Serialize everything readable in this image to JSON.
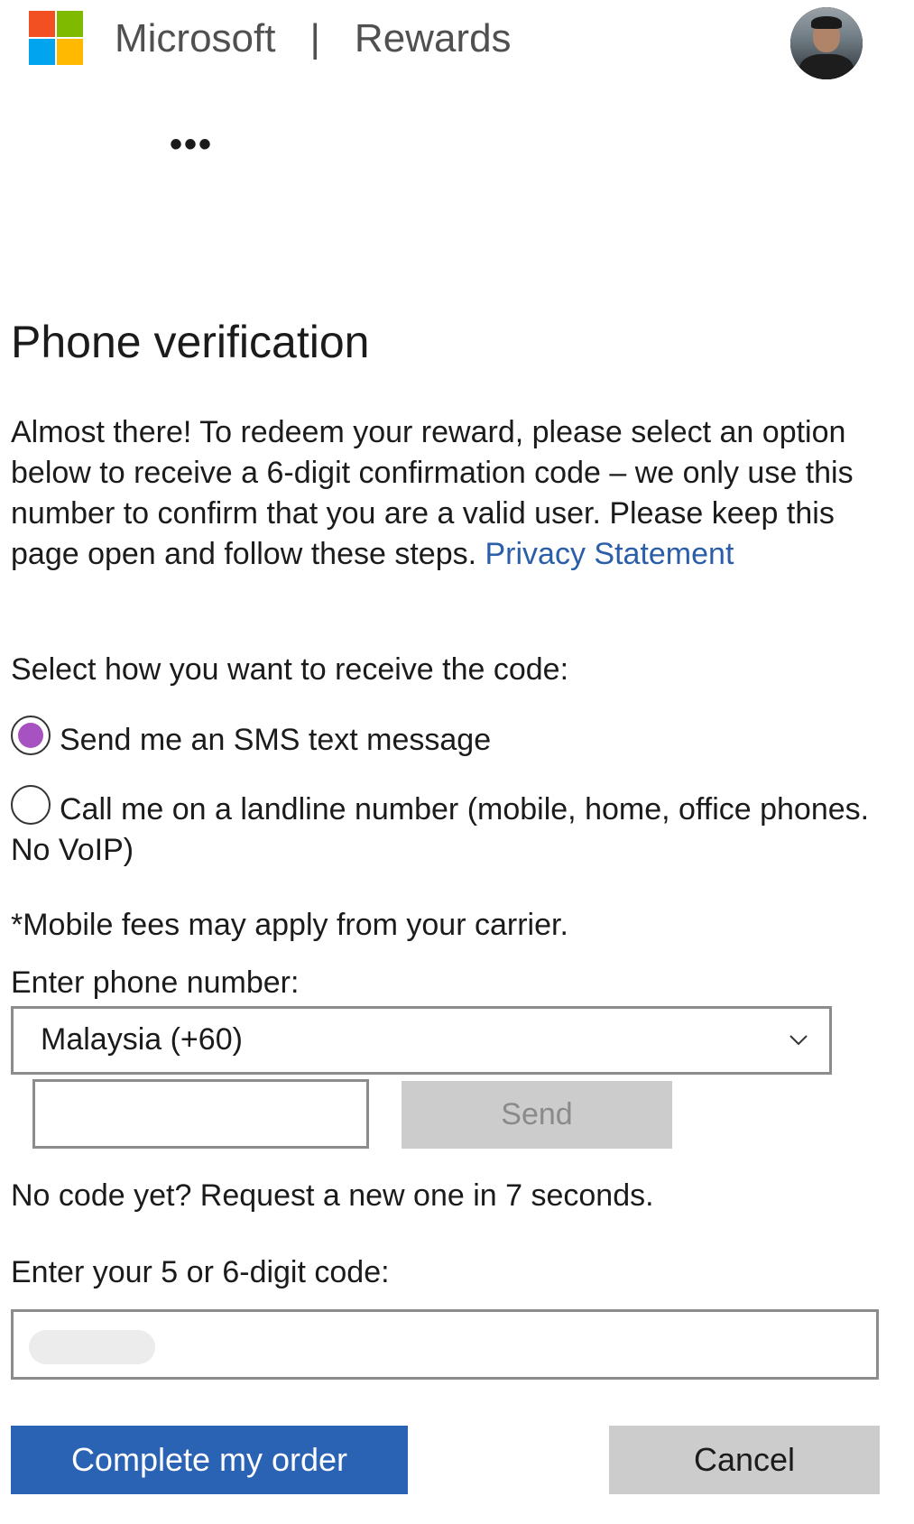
{
  "header": {
    "brand": "Microsoft",
    "separator": "|",
    "product": "Rewards",
    "more_icon": "•••"
  },
  "verification": {
    "title": "Phone verification",
    "intro": "Almost there! To redeem your reward, please select an option below to receive a 6-digit confirmation code – we only use this number to confirm that you are a valid user. Please keep this page open and follow these steps.",
    "privacy_link": "Privacy Statement",
    "select_label": "Select how you want to receive the code:",
    "options": [
      {
        "label": "Send me an SMS text message",
        "selected": true
      },
      {
        "label": "Call me on a landline number (mobile, home, office phones. No VoIP)",
        "selected": false
      }
    ],
    "fees_note": "*Mobile fees may apply from your carrier.",
    "phone_label": "Enter phone number:",
    "country_value": "Malaysia (+60)",
    "phone_value": "",
    "send_label": "Send",
    "no_code_text": "No code yet? Request a new one in 7 seconds.",
    "code_label": "Enter your 5 or 6-digit code:",
    "code_value": "",
    "complete_label": "Complete my order",
    "cancel_label": "Cancel"
  },
  "colors": {
    "accent_blue": "#2b63b4",
    "radio_selected": "#a652c0",
    "link": "#2a5ea8",
    "disabled_button": "#cccccc"
  }
}
